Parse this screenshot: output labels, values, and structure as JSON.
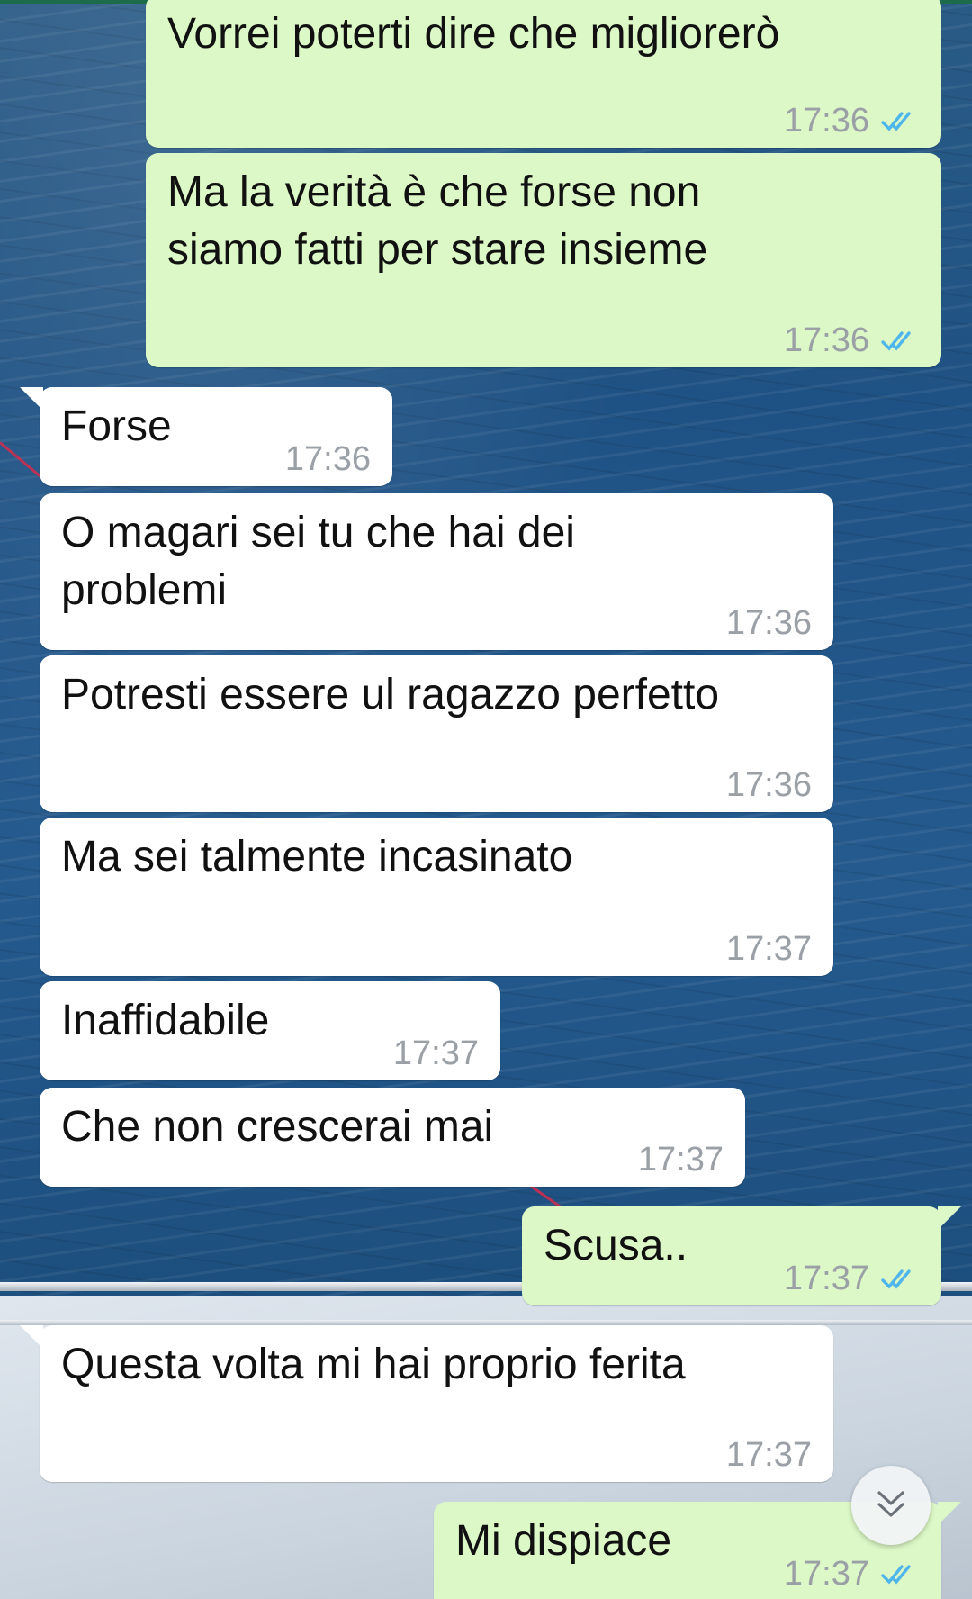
{
  "chat": {
    "messages": [
      {
        "dir": "out",
        "text": "Vorrei poterti dire che migliorerò",
        "time": "17:36",
        "status": "read"
      },
      {
        "dir": "out",
        "text": "Ma la verità è che forse non\nsiamo fatti per stare insieme",
        "time": "17:36",
        "status": "read"
      },
      {
        "dir": "in",
        "text": "Forse",
        "time": "17:36"
      },
      {
        "dir": "in",
        "text": "O magari sei tu che hai dei\nproblemi",
        "time": "17:36"
      },
      {
        "dir": "in",
        "text": "Potresti essere ul ragazzo perfetto",
        "time": "17:36"
      },
      {
        "dir": "in",
        "text": "Ma sei talmente incasinato",
        "time": "17:37"
      },
      {
        "dir": "in",
        "text": "Inaffidabile",
        "time": "17:37"
      },
      {
        "dir": "in",
        "text": "Che non crescerai mai",
        "time": "17:37"
      },
      {
        "dir": "out",
        "text": "Scusa..",
        "time": "17:37",
        "status": "read"
      },
      {
        "dir": "in",
        "text": "Questa volta mi hai proprio ferita",
        "time": "17:37"
      },
      {
        "dir": "out",
        "text": "Mi dispiace",
        "time": "17:37",
        "status": "read"
      }
    ]
  },
  "scroll_button": {
    "icon": "double-chevron-down-icon"
  },
  "colors": {
    "outgoing_bubble": "#dcf8c6",
    "incoming_bubble": "#ffffff",
    "read_ticks": "#4fb6ec",
    "timestamp": "#9aa0a6"
  }
}
